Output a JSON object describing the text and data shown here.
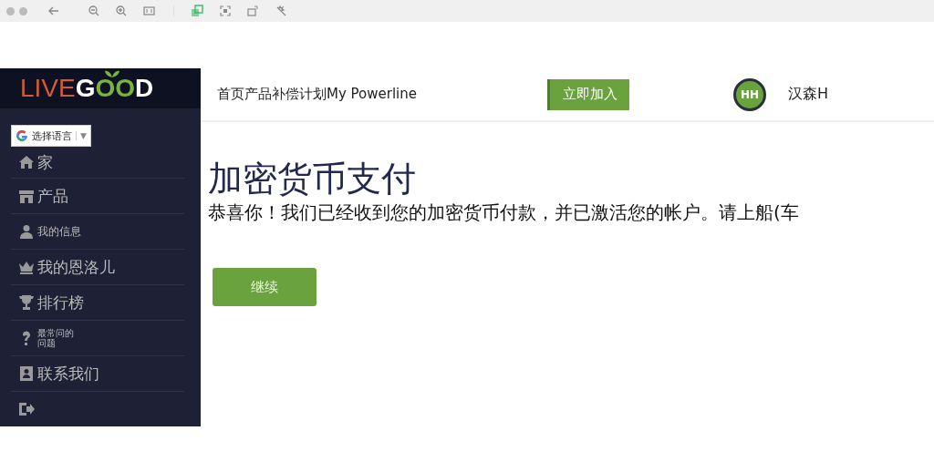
{
  "logo": {
    "first": "LIVE",
    "g": "G",
    "oo": "OO",
    "d": "D"
  },
  "language": {
    "label": "选择语言",
    "caret": "▼"
  },
  "sidebar": {
    "items": [
      {
        "label": "家",
        "kind": "big"
      },
      {
        "label": "产品",
        "kind": "big"
      },
      {
        "label": "我的信息",
        "kind": "small"
      },
      {
        "label": "我的恩洛儿",
        "kind": "big"
      },
      {
        "label": "排行榜",
        "kind": "big"
      },
      {
        "label": "最常问的问题",
        "kind": "tiny"
      },
      {
        "label": "联系我们",
        "kind": "big"
      }
    ]
  },
  "header": {
    "nav": "首页产品补偿计划My Powerline",
    "join_button": "立即加入",
    "avatar": "HH",
    "user_name": "汉森H"
  },
  "content": {
    "title": "加密货币支付",
    "message": "恭喜你！我们已经收到您的加密货币付款，并已激活您的帐户。请上船(车",
    "button": "继续"
  }
}
